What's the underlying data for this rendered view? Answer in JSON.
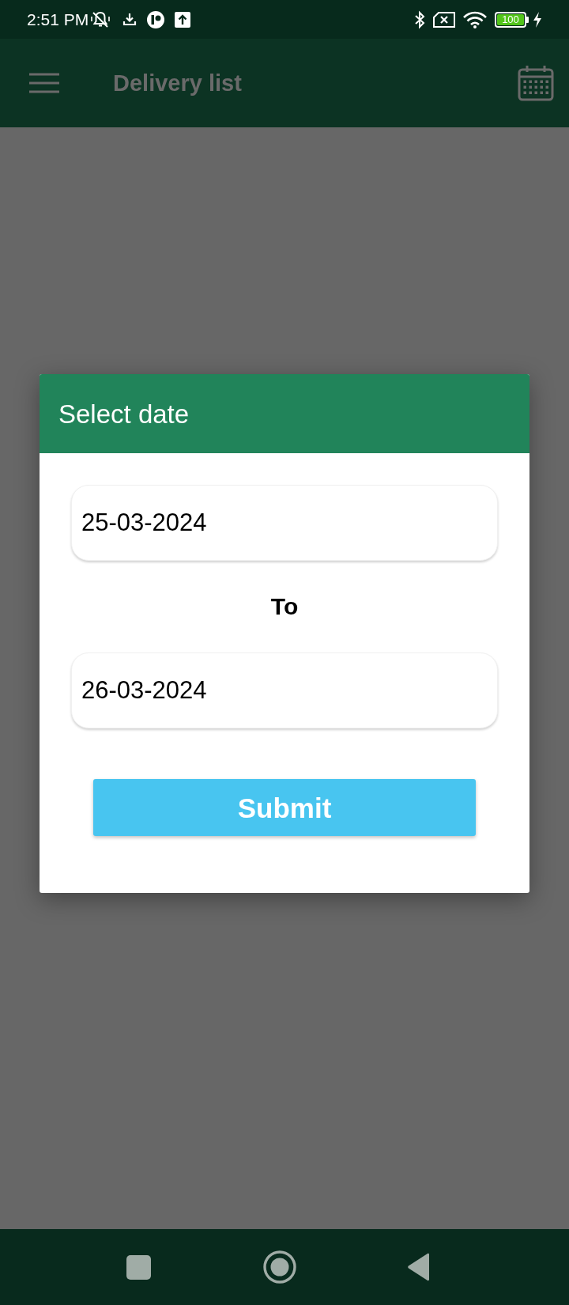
{
  "status_bar": {
    "time": "2:51 PM",
    "battery": "100"
  },
  "app_bar": {
    "title": "Delivery list"
  },
  "dialog": {
    "title": "Select date",
    "from_date": {
      "value": "25-03-2024"
    },
    "separator": "To",
    "to_date": {
      "value": "26-03-2024"
    },
    "submit_button": "Submit"
  }
}
